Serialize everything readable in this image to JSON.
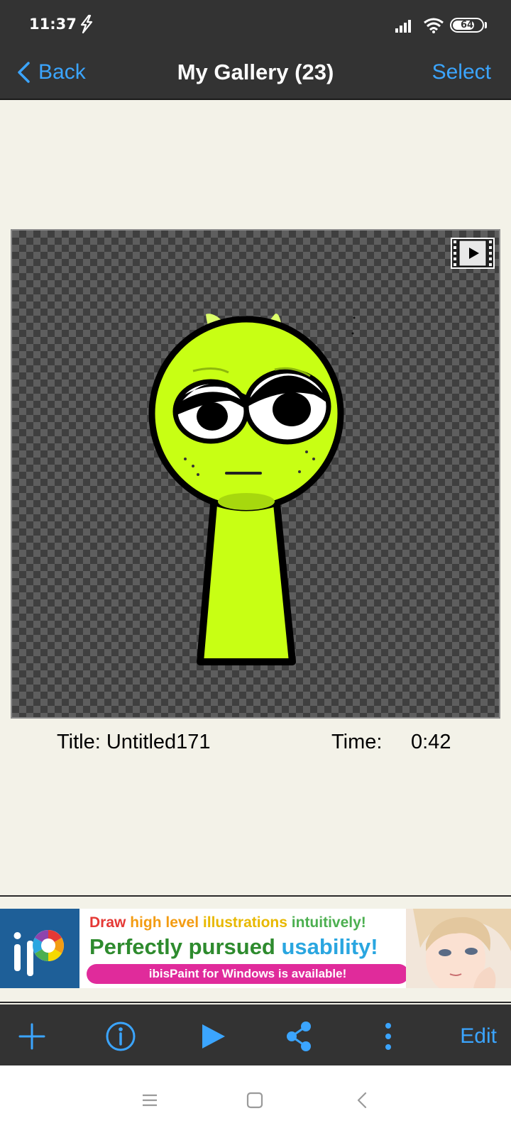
{
  "status_bar": {
    "time": "11:37",
    "battery_level": "64",
    "icons": [
      "bolt-icon",
      "signal-icon",
      "wifi-icon",
      "battery-icon"
    ]
  },
  "nav": {
    "back_label": "Back",
    "title": "My Gallery (23)",
    "select_label": "Select"
  },
  "artwork": {
    "title_label": "Title: Untitled171",
    "time_label": "Time:",
    "time_value": "0:42",
    "badge_icon": "video-play-icon"
  },
  "ad": {
    "line1": [
      "Draw",
      "high level",
      "illustrations",
      "intuitively!"
    ],
    "line2": [
      "Perfectly pursued",
      "usability!"
    ],
    "pill_text": "ibisPaint for Windows is available!"
  },
  "toolbar": {
    "icons": [
      "add-icon",
      "info-icon",
      "play-icon",
      "share-icon",
      "more-vertical-icon"
    ],
    "edit_label": "Edit"
  },
  "system_nav": {
    "icons": [
      "menu-icon",
      "home-icon",
      "back-icon"
    ]
  },
  "colors": {
    "accent": "#3ba5ff",
    "bar_background": "#333333",
    "page_background": "#f3f2e8",
    "character_green": "#c8ff14"
  }
}
